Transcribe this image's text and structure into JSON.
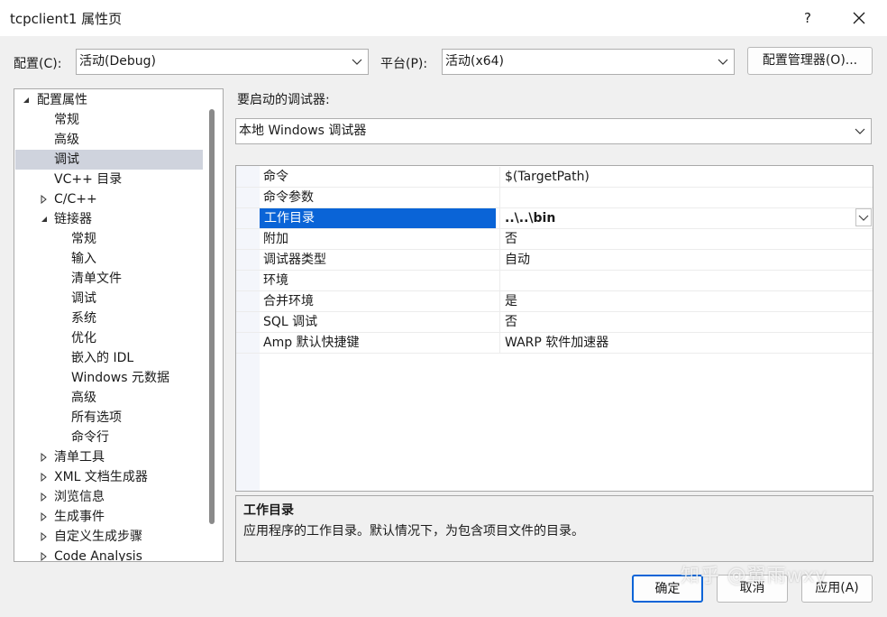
{
  "window": {
    "title": "tcpclient1 属性页",
    "help": "?"
  },
  "config": {
    "label": "配置(C):",
    "value": "活动(Debug)",
    "platform_label": "平台(P):",
    "platform_value": "活动(x64)",
    "manager_button": "配置管理器(O)..."
  },
  "tree": {
    "root": "配置属性",
    "items": [
      "常规",
      "高级",
      "调试",
      "VC++ 目录",
      "C/C++",
      "链接器",
      "常规",
      "输入",
      "清单文件",
      "调试",
      "系统",
      "优化",
      "嵌入的 IDL",
      "Windows 元数据",
      "高级",
      "所有选项",
      "命令行",
      "清单工具",
      "XML 文档生成器",
      "浏览信息",
      "生成事件",
      "自定义生成步骤",
      "Code Analysis"
    ]
  },
  "debugger": {
    "label": "要启动的调试器:",
    "value": "本地 Windows 调试器"
  },
  "grid": {
    "rows": [
      {
        "key": "命令",
        "value": "$(TargetPath)"
      },
      {
        "key": "命令参数",
        "value": ""
      },
      {
        "key": "工作目录",
        "value": "..\\..\\bin"
      },
      {
        "key": "附加",
        "value": "否"
      },
      {
        "key": "调试器类型",
        "value": "自动"
      },
      {
        "key": "环境",
        "value": ""
      },
      {
        "key": "合并环境",
        "value": "是"
      },
      {
        "key": "SQL 调试",
        "value": "否"
      },
      {
        "key": "Amp 默认快捷键",
        "value": "WARP 软件加速器"
      }
    ],
    "selected_index": 2
  },
  "description": {
    "title": "工作目录",
    "text": "应用程序的工作目录。默认情况下，为包含项目文件的目录。"
  },
  "buttons": {
    "ok": "确定",
    "cancel": "取消",
    "apply": "应用(A)"
  },
  "watermark": "知乎 @翼雨wxy",
  "colors": {
    "selection": "#0a64d7",
    "tree_selection": "#cfd3dd",
    "background": "#f0f0f0"
  }
}
